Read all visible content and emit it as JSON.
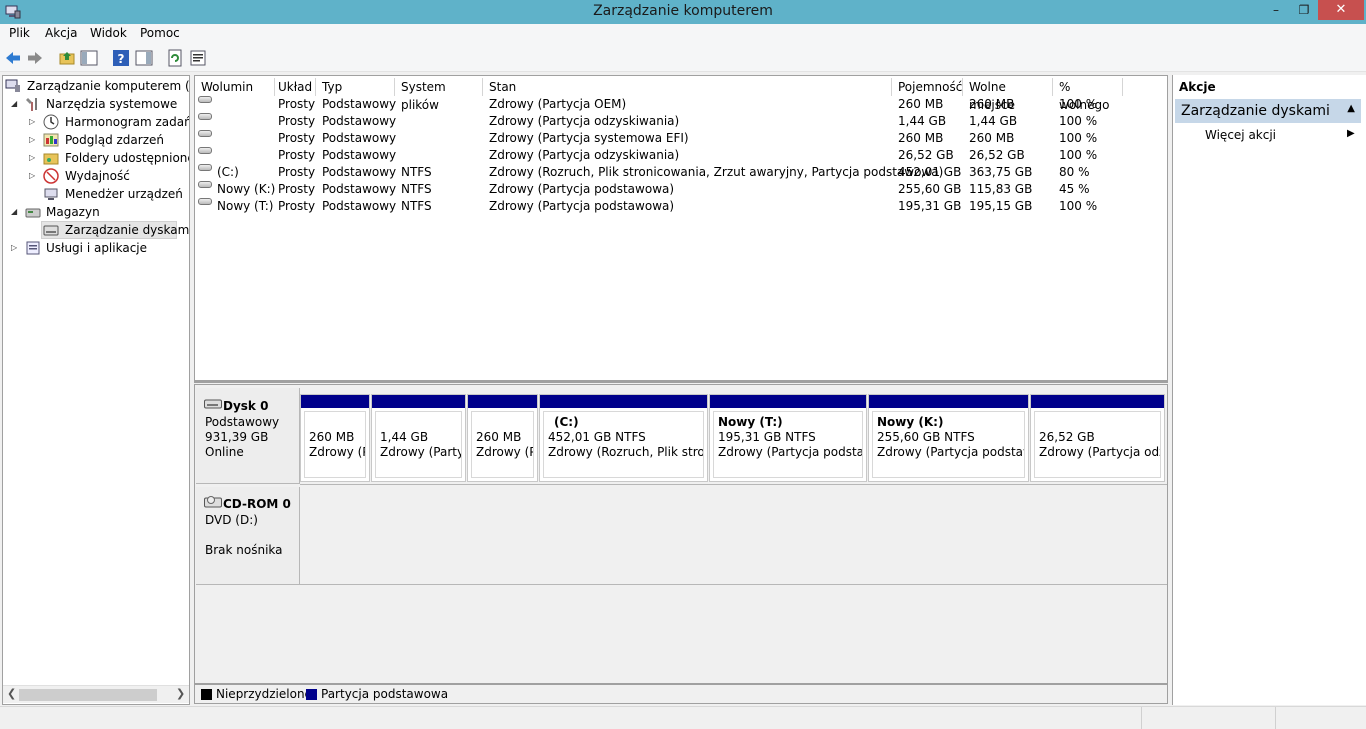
{
  "window": {
    "title": "Zarządzanie komputerem",
    "minimize": "–",
    "maximize": "❐",
    "close": "✕"
  },
  "menu": [
    "Plik",
    "Akcja",
    "Widok",
    "Pomoc"
  ],
  "tree": {
    "root": "Zarządzanie komputerem (lokalny)",
    "system_tools": "Narzędzia systemowe",
    "task_scheduler": "Harmonogram zadań",
    "event_viewer": "Podgląd zdarzeń",
    "shared_folders": "Foldery udostępnione",
    "performance": "Wydajność",
    "device_manager": "Menedżer urządzeń",
    "storage": "Magazyn",
    "disk_management": "Zarządzanie dyskami",
    "services": "Usługi i aplikacje"
  },
  "list": {
    "columns": [
      "Wolumin",
      "Układ",
      "Typ",
      "System plików",
      "Stan",
      "Pojemność",
      "Wolne miejsce",
      "% wolnego"
    ],
    "rows": [
      {
        "volume": "",
        "layout": "Prosty",
        "type": "Podstawowy",
        "fs": "",
        "status": "Zdrowy (Partycja OEM)",
        "capacity": "260 MB",
        "free": "260 MB",
        "pct": "100 %"
      },
      {
        "volume": "",
        "layout": "Prosty",
        "type": "Podstawowy",
        "fs": "",
        "status": "Zdrowy (Partycja odzyskiwania)",
        "capacity": "1,44 GB",
        "free": "1,44 GB",
        "pct": "100 %"
      },
      {
        "volume": "",
        "layout": "Prosty",
        "type": "Podstawowy",
        "fs": "",
        "status": "Zdrowy (Partycja systemowa EFI)",
        "capacity": "260 MB",
        "free": "260 MB",
        "pct": "100 %"
      },
      {
        "volume": "",
        "layout": "Prosty",
        "type": "Podstawowy",
        "fs": "",
        "status": "Zdrowy (Partycja odzyskiwania)",
        "capacity": "26,52 GB",
        "free": "26,52 GB",
        "pct": "100 %"
      },
      {
        "volume": "(C:)",
        "layout": "Prosty",
        "type": "Podstawowy",
        "fs": "NTFS",
        "status": "Zdrowy (Rozruch, Plik stronicowania, Zrzut awaryjny, Partycja podstawowa)",
        "capacity": "452,01 GB",
        "free": "363,75 GB",
        "pct": "80 %"
      },
      {
        "volume": "Nowy (K:)",
        "layout": "Prosty",
        "type": "Podstawowy",
        "fs": "NTFS",
        "status": "Zdrowy (Partycja podstawowa)",
        "capacity": "255,60 GB",
        "free": "115,83 GB",
        "pct": "45 %"
      },
      {
        "volume": "Nowy (T:)",
        "layout": "Prosty",
        "type": "Podstawowy",
        "fs": "NTFS",
        "status": "Zdrowy (Partycja podstawowa)",
        "capacity": "195,31 GB",
        "free": "195,15 GB",
        "pct": "100 %"
      }
    ]
  },
  "disk0": {
    "name": "Dysk 0",
    "type": "Podstawowy",
    "size": "931,39 GB",
    "state": "Online",
    "partitions": [
      {
        "title": "",
        "size": "260 MB",
        "status": "Zdrowy (Pa"
      },
      {
        "title": "",
        "size": "1,44 GB",
        "status": "Zdrowy (Partyc"
      },
      {
        "title": "",
        "size": "260 MB",
        "status": "Zdrowy (Pa"
      },
      {
        "title": "(C:)",
        "size": "452,01 GB NTFS",
        "status": "Zdrowy (Rozruch, Plik stronic"
      },
      {
        "title": "Nowy  (T:)",
        "size": "195,31 GB NTFS",
        "status": "Zdrowy (Partycja podstawo"
      },
      {
        "title": "Nowy  (K:)",
        "size": "255,60 GB NTFS",
        "status": "Zdrowy (Partycja podstawow"
      },
      {
        "title": "",
        "size": "26,52 GB",
        "status": "Zdrowy (Partycja odzys"
      }
    ]
  },
  "cdrom": {
    "name": "CD-ROM 0",
    "drive": "DVD (D:)",
    "media": "Brak nośnika"
  },
  "legend": {
    "unallocated": "Nieprzydzielone",
    "primary": "Partycja podstawowa"
  },
  "actions": {
    "header": "Akcje",
    "section": "Zarządzanie dyskami",
    "more": "Więcej akcji"
  },
  "colors": {
    "titlebar": "#5fb2c9",
    "partition_band": "#00008b",
    "close_button": "#c7504f",
    "actions_section": "#c6d7e8"
  }
}
